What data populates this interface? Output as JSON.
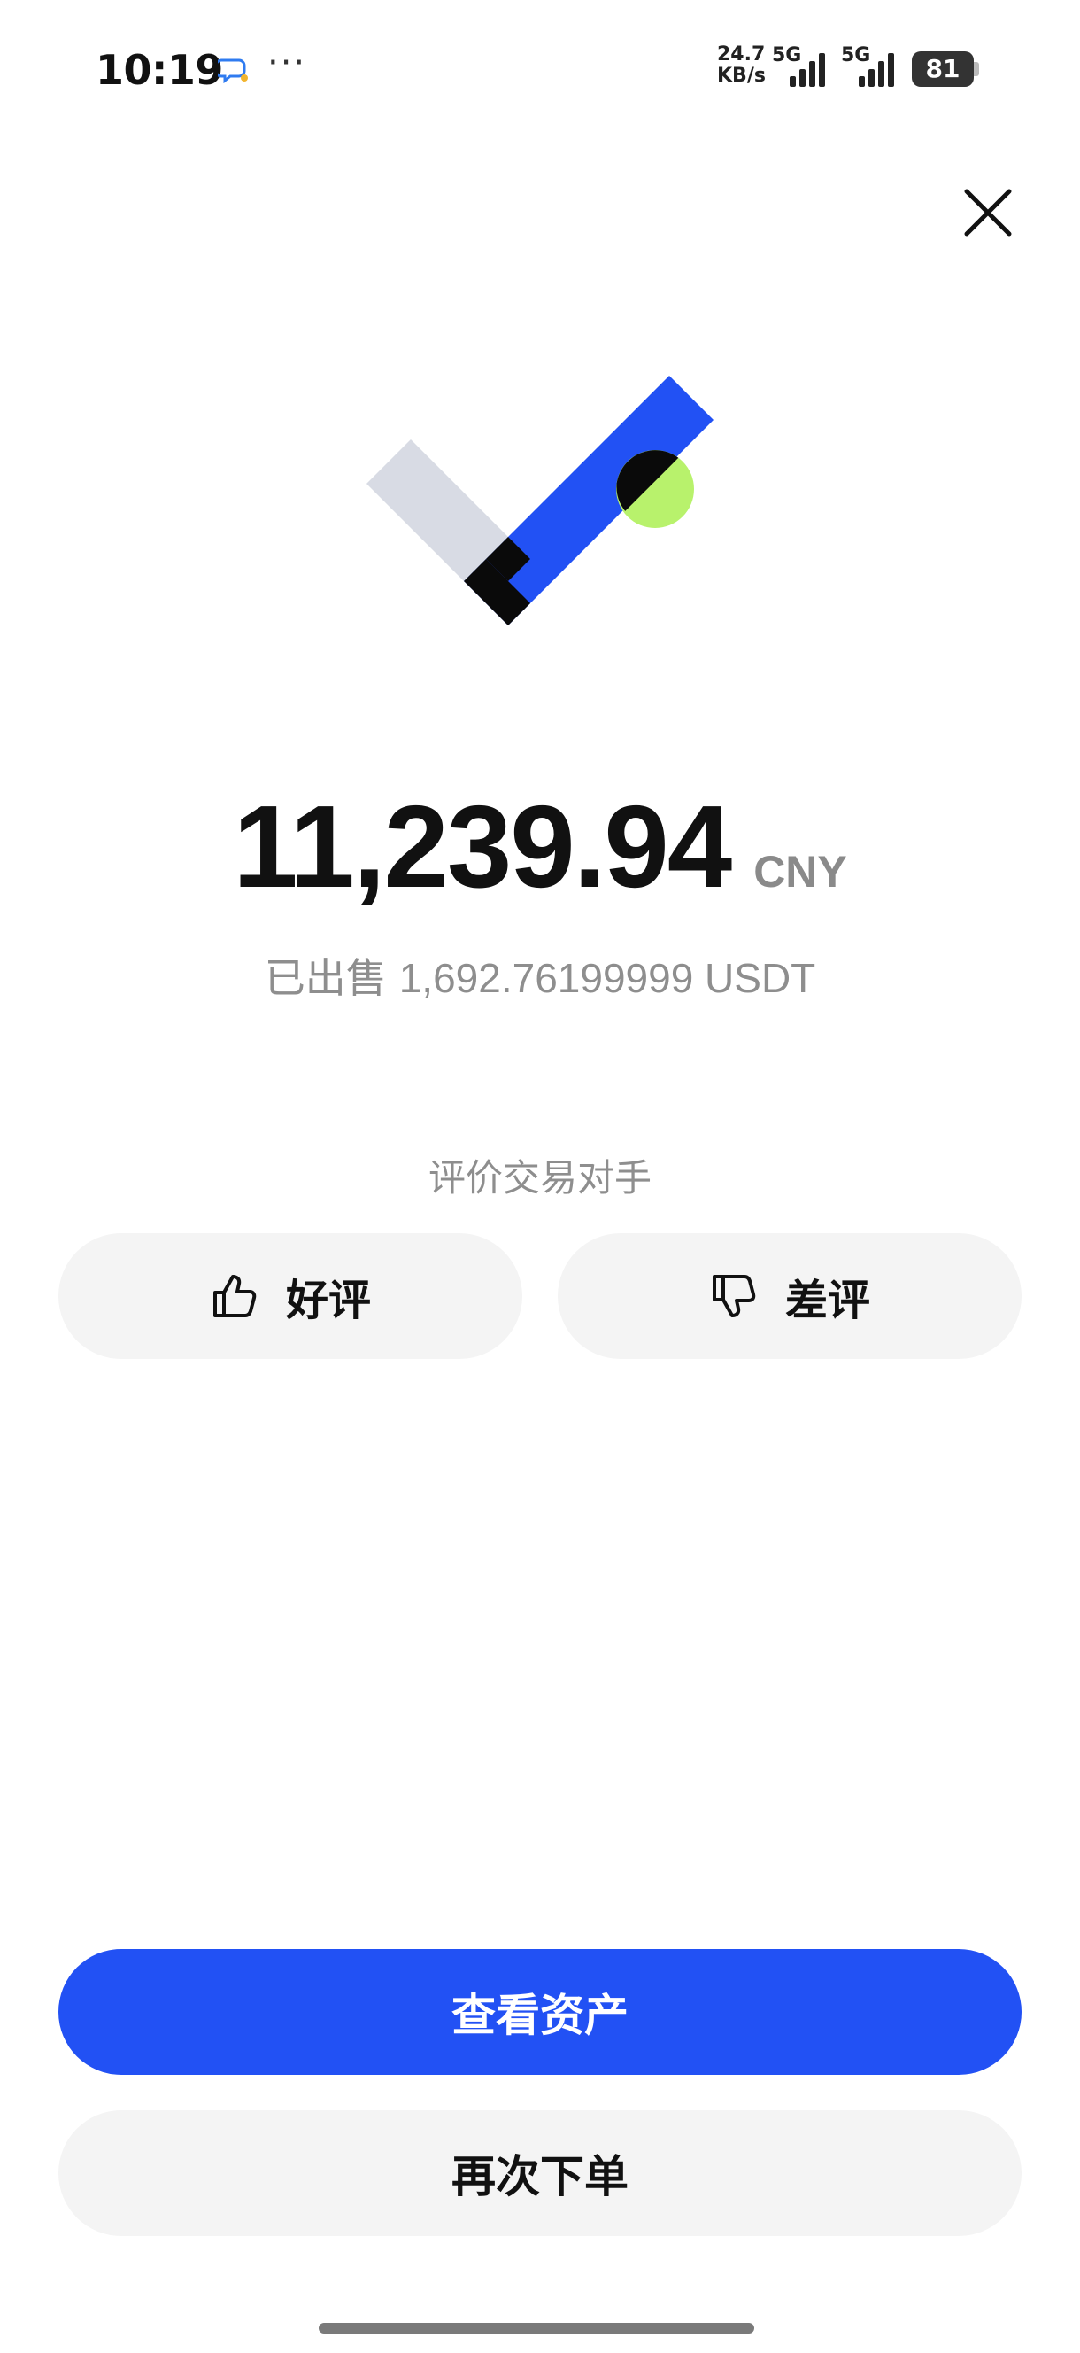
{
  "status_bar": {
    "time": "10:19",
    "net_speed_value": "24.7",
    "net_speed_unit": "KB/s",
    "signal_1_label": "5G",
    "signal_2_label": "5G",
    "battery": "81",
    "chat_icon": "chat-bubble-icon",
    "more_icon": "more-dots-icon"
  },
  "header": {
    "close_icon": "close-icon"
  },
  "result": {
    "amount": "11,239.94",
    "currency": "CNY",
    "sold_prefix": "已出售",
    "sold_value": "1,692.76199999 USDT"
  },
  "rating": {
    "title": "评价交易对手",
    "good_label": "好评",
    "good_icon": "thumbs-up-icon",
    "bad_label": "差评",
    "bad_icon": "thumbs-down-icon"
  },
  "actions": {
    "view_assets": "查看资产",
    "order_again": "再次下单"
  },
  "colors": {
    "primary": "#2251f4",
    "accent_green": "#b8f26c",
    "button_gray": "#f4f4f4",
    "muted_text": "#8e8e8e"
  }
}
